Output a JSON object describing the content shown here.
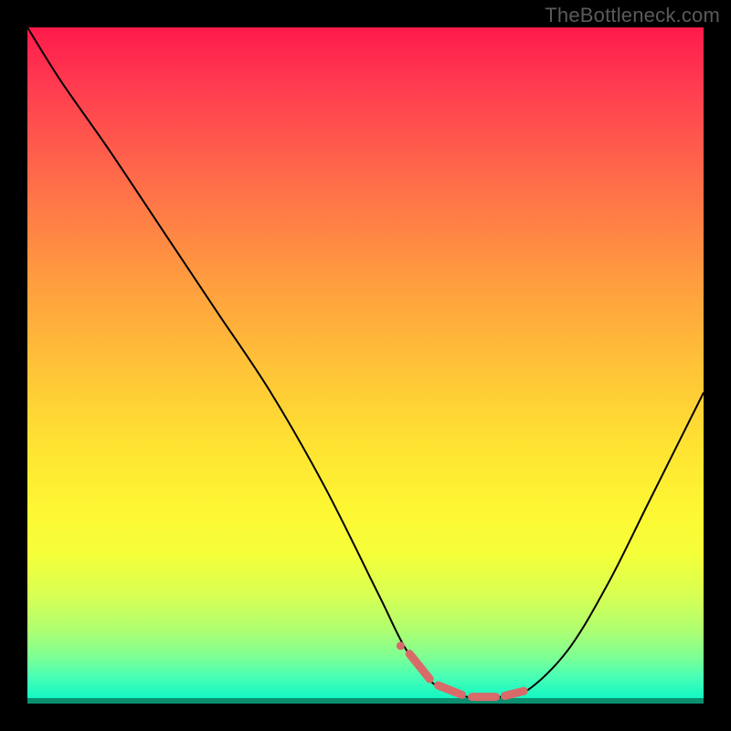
{
  "watermark": "TheBottleneck.com",
  "chart_data": {
    "type": "line",
    "title": "",
    "xlabel": "",
    "ylabel": "",
    "xlim": [
      0,
      100
    ],
    "ylim": [
      0,
      100
    ],
    "grid": false,
    "legend": false,
    "background_gradient": {
      "orientation": "vertical",
      "stops": [
        {
          "offset": 0.0,
          "color": "#ff1a4b"
        },
        {
          "offset": 0.22,
          "color": "#ff6a4a"
        },
        {
          "offset": 0.5,
          "color": "#ffc238"
        },
        {
          "offset": 0.72,
          "color": "#fdf833"
        },
        {
          "offset": 0.89,
          "color": "#b0ff70"
        },
        {
          "offset": 1.0,
          "color": "#08e9c5"
        }
      ]
    },
    "series": [
      {
        "name": "bottleneck-curve",
        "type": "line",
        "color": "#000000",
        "x": [
          0,
          5,
          12,
          20,
          28,
          36,
          44,
          52,
          56,
          60,
          65,
          70,
          74,
          80,
          86,
          92,
          100
        ],
        "y": [
          100,
          92,
          82,
          70,
          58,
          46,
          32,
          16,
          8,
          3,
          1,
          1,
          2,
          8,
          18,
          30,
          46
        ]
      },
      {
        "name": "optimal-flat-region",
        "type": "line",
        "color": "#d86a6a",
        "style": "thick-dashed",
        "x": [
          56,
          60,
          65,
          70,
          74
        ],
        "y": [
          8,
          3,
          1,
          1,
          2
        ]
      }
    ],
    "annotations": []
  }
}
